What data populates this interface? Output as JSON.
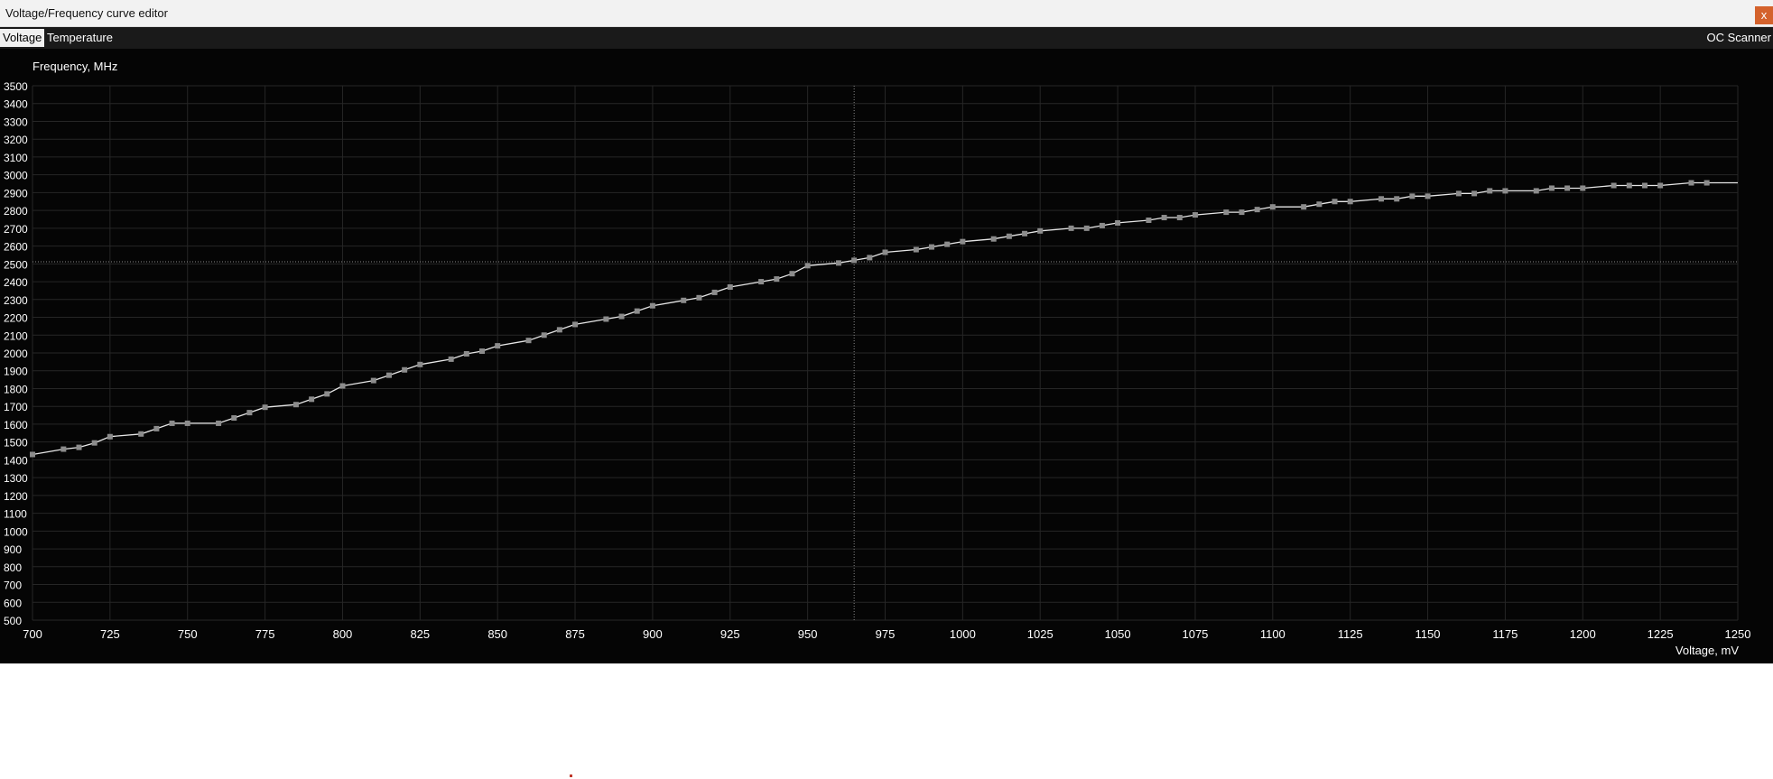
{
  "window": {
    "title": "Voltage/Frequency curve editor",
    "close_label": "x"
  },
  "tabs": [
    {
      "label": "Voltage",
      "active": true
    },
    {
      "label": "Temperature",
      "active": false
    }
  ],
  "toolbar": {
    "oc_scanner_label": "OC Scanner"
  },
  "colors": {
    "background": "#050505",
    "grid": "#262626",
    "curve": "#e6e6e6",
    "point": "#8c8c8c",
    "crosshair": "#8a8a8a",
    "close_button": "#d4622c"
  },
  "chart_data": {
    "type": "line",
    "title": "",
    "ylabel": "Frequency, MHz",
    "xlabel": "Voltage, mV",
    "xlim": [
      700,
      1250
    ],
    "ylim": [
      500,
      3500
    ],
    "x_ticks": [
      700,
      725,
      750,
      775,
      800,
      825,
      850,
      875,
      900,
      925,
      950,
      975,
      1000,
      1025,
      1050,
      1075,
      1100,
      1125,
      1150,
      1175,
      1200,
      1225,
      1250
    ],
    "y_ticks": [
      500,
      600,
      700,
      800,
      900,
      1000,
      1100,
      1200,
      1300,
      1400,
      1500,
      1600,
      1700,
      1800,
      1900,
      2000,
      2100,
      2200,
      2300,
      2400,
      2500,
      2600,
      2700,
      2800,
      2900,
      3000,
      3100,
      3200,
      3300,
      3400,
      3500
    ],
    "grid": true,
    "crosshair": {
      "x": 965,
      "y": 2512
    },
    "series": [
      {
        "x": [
          700,
          710,
          715,
          720,
          725,
          735,
          740,
          745,
          750,
          760,
          765,
          770,
          775,
          785,
          790,
          795,
          800,
          810,
          815,
          820,
          825,
          835,
          840,
          845,
          850,
          860,
          865,
          870,
          875,
          885,
          890,
          895,
          900,
          910,
          915,
          920,
          925,
          935,
          940,
          945,
          950,
          960,
          965,
          970,
          975,
          985,
          990,
          995,
          1000,
          1010,
          1015,
          1020,
          1025,
          1035,
          1040,
          1045,
          1050,
          1060,
          1065,
          1070,
          1075,
          1085,
          1090,
          1095,
          1100,
          1110,
          1115,
          1120,
          1125,
          1135,
          1140,
          1145,
          1150,
          1160,
          1165,
          1170,
          1175,
          1185,
          1190,
          1195,
          1200,
          1210,
          1215,
          1220,
          1225,
          1235,
          1240,
          1250
        ],
        "values": [
          1430,
          1460,
          1470,
          1495,
          1530,
          1545,
          1575,
          1605,
          1605,
          1605,
          1635,
          1665,
          1695,
          1710,
          1740,
          1770,
          1815,
          1845,
          1875,
          1905,
          1935,
          1965,
          1995,
          2010,
          2040,
          2070,
          2100,
          2130,
          2160,
          2190,
          2205,
          2235,
          2265,
          2295,
          2310,
          2340,
          2370,
          2400,
          2415,
          2445,
          2490,
          2505,
          2520,
          2535,
          2565,
          2580,
          2595,
          2610,
          2625,
          2640,
          2655,
          2670,
          2685,
          2700,
          2700,
          2715,
          2730,
          2745,
          2760,
          2760,
          2775,
          2790,
          2790,
          2805,
          2820,
          2820,
          2835,
          2850,
          2850,
          2865,
          2865,
          2880,
          2880,
          2895,
          2895,
          2910,
          2910,
          2910,
          2925,
          2925,
          2925,
          2940,
          2940,
          2940,
          2940,
          2955,
          2955,
          2955
        ]
      }
    ]
  }
}
